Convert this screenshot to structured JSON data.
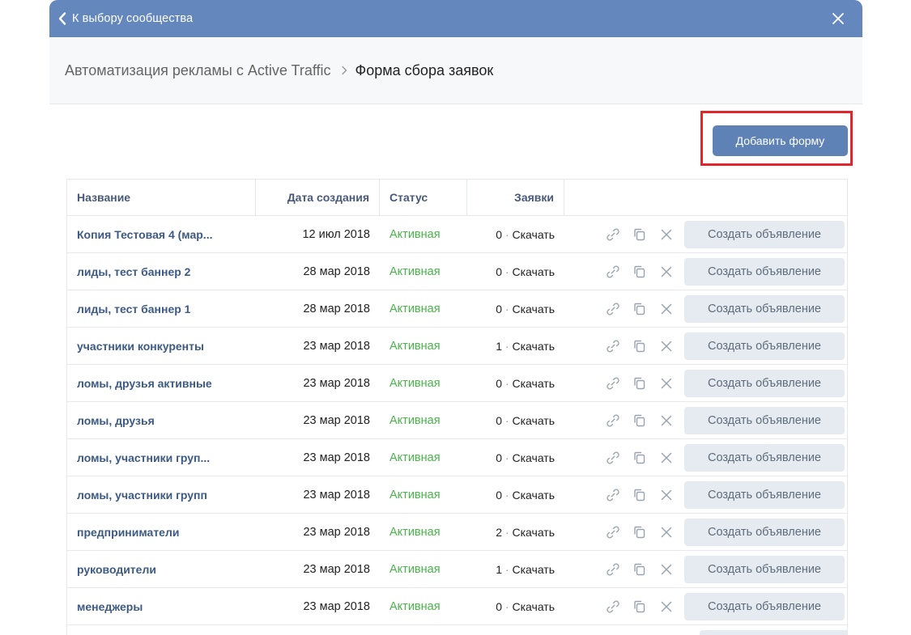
{
  "topbar": {
    "back_label": "К выбору сообщества",
    "back_icon": "chevron-left-icon",
    "close_icon": "close-icon"
  },
  "breadcrumb": {
    "parent": "Автоматизация рекламы с Active Traffic",
    "separator_icon": "chevron-right-icon",
    "current": "Форма сбора заявок"
  },
  "toolbar": {
    "add_form_label": "Добавить форму"
  },
  "table": {
    "headers": {
      "name": "Название",
      "date": "Дата создания",
      "status": "Статус",
      "leads": "Заявки"
    },
    "rows": [
      {
        "name": "Копия Тестовая 4 (мар...",
        "date": "12 июл 2018",
        "status": "Активная",
        "count": "0",
        "download": "Скачать",
        "action": "Создать объявление"
      },
      {
        "name": "лиды, тест баннер 2",
        "date": "28 мар 2018",
        "status": "Активная",
        "count": "0",
        "download": "Скачать",
        "action": "Создать объявление"
      },
      {
        "name": "лиды, тест баннер 1",
        "date": "28 мар 2018",
        "status": "Активная",
        "count": "0",
        "download": "Скачать",
        "action": "Создать объявление"
      },
      {
        "name": "участники конкуренты",
        "date": "23 мар 2018",
        "status": "Активная",
        "count": "1",
        "download": "Скачать",
        "action": "Создать объявление"
      },
      {
        "name": "ломы, друзья активные",
        "date": "23 мар 2018",
        "status": "Активная",
        "count": "0",
        "download": "Скачать",
        "action": "Создать объявление"
      },
      {
        "name": "ломы, друзья",
        "date": "23 мар 2018",
        "status": "Активная",
        "count": "0",
        "download": "Скачать",
        "action": "Создать объявление"
      },
      {
        "name": "ломы, участники груп...",
        "date": "23 мар 2018",
        "status": "Активная",
        "count": "0",
        "download": "Скачать",
        "action": "Создать объявление"
      },
      {
        "name": "ломы, участники групп",
        "date": "23 мар 2018",
        "status": "Активная",
        "count": "0",
        "download": "Скачать",
        "action": "Создать объявление"
      },
      {
        "name": "предприниматели",
        "date": "23 мар 2018",
        "status": "Активная",
        "count": "2",
        "download": "Скачать",
        "action": "Создать объявление"
      },
      {
        "name": "руководители",
        "date": "23 мар 2018",
        "status": "Активная",
        "count": "1",
        "download": "Скачать",
        "action": "Создать объявление"
      },
      {
        "name": "менеджеры",
        "date": "23 мар 2018",
        "status": "Активная",
        "count": "0",
        "download": "Скачать",
        "action": "Создать объявление"
      }
    ],
    "row_icons": [
      "link-icon",
      "copy-icon",
      "delete-icon"
    ]
  },
  "colors": {
    "header_bar": "#6487be",
    "primary_button": "#5f82b6",
    "status_active": "#4bb34b",
    "link_text": "#3d5a85",
    "highlight_frame": "#e0262a"
  }
}
